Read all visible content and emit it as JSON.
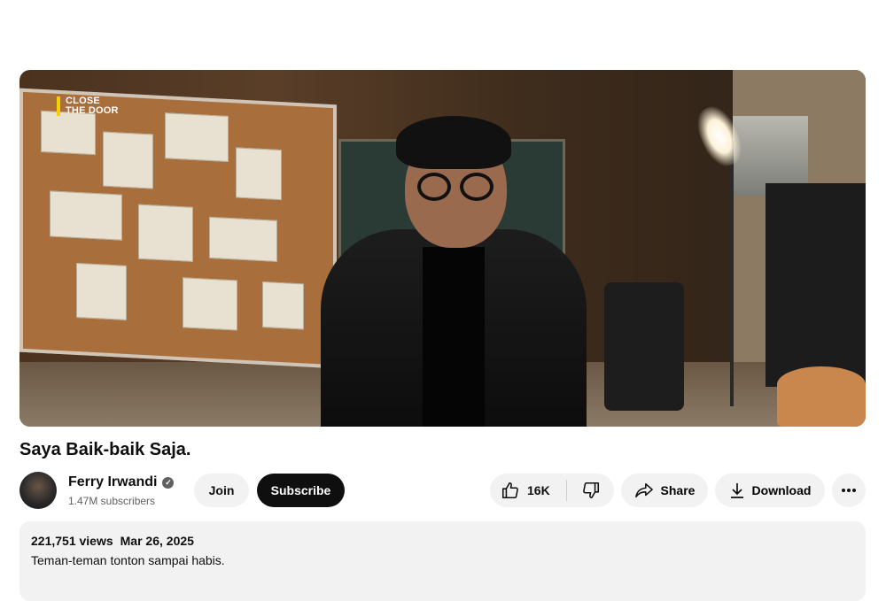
{
  "video": {
    "overlay_logo_line1": "CLOSE",
    "overlay_logo_line2": "THE DOOR",
    "title": "Saya Baik-baik Saja."
  },
  "channel": {
    "name": "Ferry Irwandi",
    "subscribers": "1.47M subscribers",
    "verified_icon": "checkmark-icon"
  },
  "actions": {
    "join_label": "Join",
    "subscribe_label": "Subscribe",
    "like_count": "16K",
    "share_label": "Share",
    "download_label": "Download",
    "more_icon": "ellipsis-icon"
  },
  "description": {
    "views": "221,751 views",
    "date": "Mar 26, 2025",
    "text": "Teman-teman tonton sampai habis."
  },
  "colors": {
    "subscribe_bg": "#0f0f0f",
    "button_bg": "#f2f2f2",
    "logo_accent": "#f5d000"
  }
}
